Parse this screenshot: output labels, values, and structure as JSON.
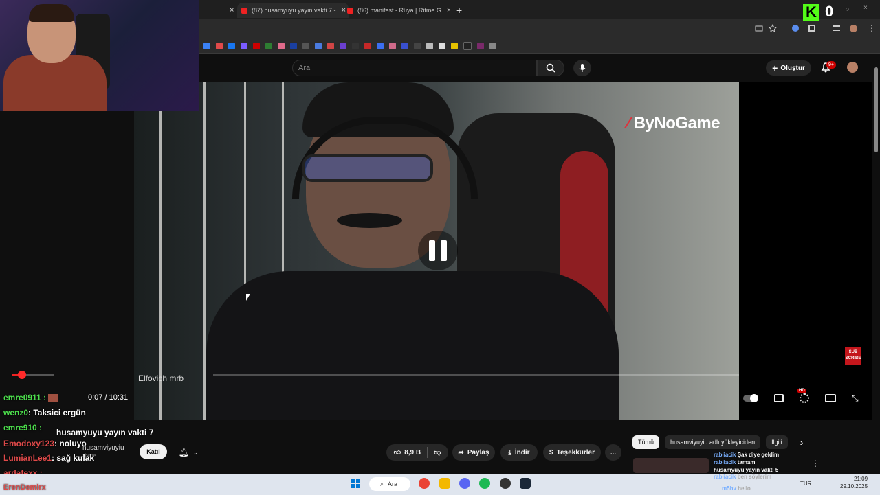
{
  "browser": {
    "tabs": [
      {
        "label": "(87) husamyuyu yayın vakti 7 -"
      },
      {
        "label": "(86) manifest - Rüya | Ritme G"
      }
    ],
    "new_tab_label": "+",
    "close_label": "×"
  },
  "kick": {
    "logo": "K",
    "count": "0"
  },
  "youtube": {
    "search_placeholder": "Ara",
    "create_label": "Oluştur",
    "notif_badge": "9+"
  },
  "video": {
    "watermark": "ByNoGame",
    "subtitle": "Elfovich mrb",
    "time": "0:07 / 10:31",
    "hd_badge": "HD",
    "subscribe_badge": "SUB SCRIBE"
  },
  "chat": [
    {
      "user": "emre0911 :",
      "text": ""
    },
    {
      "user": "wenz0",
      "text": ": Taksici ergün"
    },
    {
      "user": "emre910 :",
      "text": "husamyuyu yayın vakti 7"
    },
    {
      "user": "Emodoxy123",
      "text": ": noluyo"
    },
    {
      "user": "LumianLee1",
      "text": ": sağ kulak"
    },
    {
      "user": "ardafexx :",
      "text": ""
    },
    {
      "user": "ErenDemirx",
      "text": ""
    }
  ],
  "channel": {
    "name": "husamviyuyiu",
    "subs": "abone",
    "join_label": "Katıl"
  },
  "actions": {
    "likes": "8,9 B",
    "share": "Paylaş",
    "download": "İndir",
    "thanks": "Teşekkürler",
    "more": "..."
  },
  "chips": [
    {
      "label": "Tümü",
      "active": true
    },
    {
      "label": "husamviyuyiu adlı yükleyiciden",
      "active": false
    },
    {
      "label": "İlgili",
      "active": false
    }
  ],
  "recommendation_overlay": [
    {
      "user": "rabiiacik",
      "text": "Şak diye geldim"
    },
    {
      "user": "rabiiacik",
      "text": "tamam"
    },
    {
      "user": "",
      "text": "husamyuyu yayın vakti 5"
    },
    {
      "user": "rabiiacik",
      "text": "ben söylerim"
    },
    {
      "user": "m5hv",
      "text": "hello"
    }
  ],
  "taskbar": {
    "search_label": "Ara",
    "lang": "TUR",
    "time": "21:09",
    "date": "29.10.2025"
  },
  "colors": {
    "accent_red": "#cc0000",
    "kick_green": "#53fc18",
    "chat_user_green": "#4de04d"
  }
}
